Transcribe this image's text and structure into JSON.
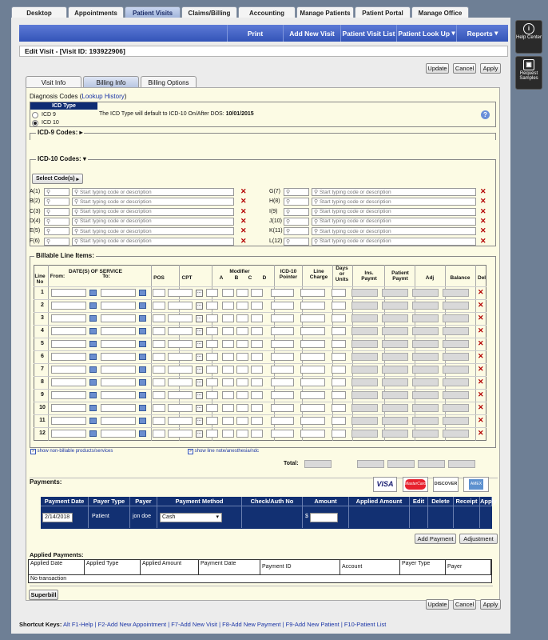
{
  "top_tabs": [
    "Desktop",
    "Appointments",
    "Patient Visits",
    "Claims/Billing",
    "Accounting",
    "Manage Patients",
    "Patient Portal",
    "Manage Office"
  ],
  "nav": {
    "items": [
      "Print",
      "Add New Visit",
      "Patient Visit List",
      "Patient Look Up",
      "Reports"
    ],
    "arrows": [
      "",
      "",
      "",
      "▾",
      "▾"
    ]
  },
  "edit_title": "Edit Visit - [Visit ID: 193922906]",
  "buttons": {
    "update": "Update",
    "cancel": "Cancel",
    "apply": "Apply",
    "select_codes": "Select Code(s)",
    "add_payment": "Add Payment",
    "adjustment": "Adjustment",
    "superbill": "Superbill"
  },
  "sub_tabs": [
    "Visit Info",
    "Billing Info",
    "Billing Options"
  ],
  "diagnosis": {
    "label": "Diagnosis Codes (",
    "link": "Lookup History",
    ")": ")",
    "icd_type_header": "ICD Type",
    "icd9": "ICD 9",
    "icd10": "ICD 10",
    "default_text": "The ICD Type will default to ICD-10 On/After DOS:",
    "default_date": "10/01/2015"
  },
  "icd9_label": "ICD-9 Codes:",
  "icd10_label": "ICD-10 Codes:",
  "icd_left_labels": [
    "A(1)",
    "B(2)",
    "C(3)",
    "D(4)",
    "E(5)",
    "F(6)"
  ],
  "icd_right_labels": [
    "G(7)",
    "H(8)",
    "I(9)",
    "J(10)",
    "K(11)",
    "L(12)"
  ],
  "search_placeholder": "Start typing code or description",
  "billable": {
    "title": "Billable Line Items:",
    "h_line": "Line No",
    "h_dos": "DATE(S) OF SERVICE",
    "h_from": "From:",
    "h_to": "To:",
    "h_pos": "POS",
    "h_cpt": "CPT",
    "h_mod": "Modifier",
    "h_a": "A",
    "h_b": "B",
    "h_c": "C",
    "h_d": "D",
    "h_icd10": "ICD-10 Pointer",
    "h_charge": "Line Charge",
    "h_days": "Days or Units",
    "h_ins": "Ins. Paymt",
    "h_pat": "Patient Paymt",
    "h_adj": "Adj",
    "h_bal": "Balance",
    "h_del": "Del",
    "rows": [
      "1",
      "2",
      "3",
      "4",
      "5",
      "6",
      "7",
      "8",
      "9",
      "10",
      "11",
      "12"
    ]
  },
  "links": {
    "nonbillable": "show non-billable products/services",
    "linenote": "show line note/anesthesia/ndc"
  },
  "total_label": "Total:",
  "payments": {
    "label": "Payments:",
    "cards": [
      "VISA",
      "MasterCard",
      "DISCOVER",
      "AMEX"
    ],
    "headers": [
      "Payment Date",
      "Payer Type",
      "Payer",
      "Payment Method",
      "Check/Auth No",
      "Amount",
      "Applied Amount",
      "Edit",
      "Delete",
      "Receipt",
      "Apply"
    ],
    "row": {
      "date": "2/14/2018",
      "payer_type": "Patient",
      "payer": "jon doe",
      "method": "Cash",
      "currency": "$"
    }
  },
  "applied": {
    "label": "Applied Payments:",
    "headers": [
      "Applied Date",
      "Applied Type",
      "Applied Amount",
      "Payment Date",
      "Payment ID",
      "Account",
      "Payer Type",
      "Payer"
    ],
    "empty": "No transaction"
  },
  "shortcuts": {
    "label": "Shortcut Keys:",
    "items": "Alt F1-Help | F2-Add New Appointment | F7-Add New Visit | F8-Add New Payment | F9-Add New Patient | F10-Patient List"
  },
  "side": {
    "help": "Help Center",
    "request": "Request Samples"
  },
  "colors": {
    "nav": "#3354b8",
    "pay_header": "#123072",
    "delete_x": "#b40000",
    "content_bg": "#fcfbe4"
  }
}
